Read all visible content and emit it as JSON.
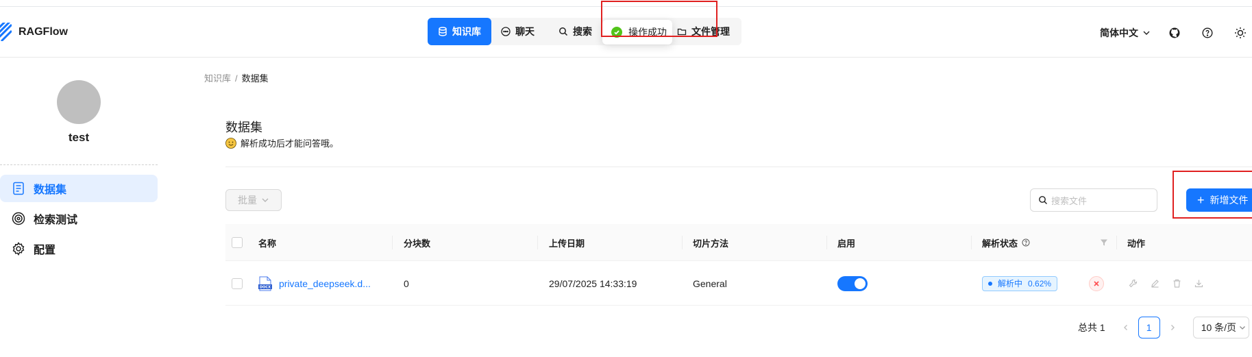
{
  "app": {
    "name": "RAGFlow"
  },
  "nav": {
    "items": [
      {
        "label": "知识库",
        "icon": "database-icon",
        "active": true
      },
      {
        "label": "聊天",
        "icon": "chat-icon",
        "active": false
      },
      {
        "label": "搜索",
        "icon": "search-icon",
        "active": false
      },
      {
        "label": "文件管理",
        "icon": "folder-icon",
        "active": false
      }
    ]
  },
  "toast": {
    "text": "操作成功",
    "type": "success"
  },
  "header": {
    "language": "简体中文"
  },
  "sidebar": {
    "username": "test",
    "items": [
      {
        "label": "数据集",
        "icon": "document-icon",
        "active": true
      },
      {
        "label": "检索测试",
        "icon": "target-icon",
        "active": false
      },
      {
        "label": "配置",
        "icon": "gear-icon",
        "active": false
      }
    ]
  },
  "breadcrumb": {
    "parent": "知识库",
    "separator": "/",
    "current": "数据集"
  },
  "page": {
    "title": "数据集",
    "subtitle": "解析成功后才能问答哦。"
  },
  "toolbar": {
    "bulk_label": "批量",
    "search_placeholder": "搜索文件",
    "add_label": "新增文件"
  },
  "table": {
    "columns": [
      "名称",
      "分块数",
      "上传日期",
      "切片方法",
      "启用",
      "解析状态",
      "动作"
    ],
    "rows": [
      {
        "name": "private_deepseek.d...",
        "file_badge": "DOCX",
        "chunks": "0",
        "upload_date": "29/07/2025 14:33:19",
        "parser": "General",
        "enabled": true,
        "status_label": "解析中",
        "status_progress": "0.62%"
      }
    ]
  },
  "pagination": {
    "total_label": "总共 1",
    "current_page": "1",
    "page_size": "10 条/页"
  },
  "colors": {
    "primary": "#1677ff",
    "success": "#52c41a",
    "annotation": "#e02020",
    "danger": "#ff4d4f"
  }
}
